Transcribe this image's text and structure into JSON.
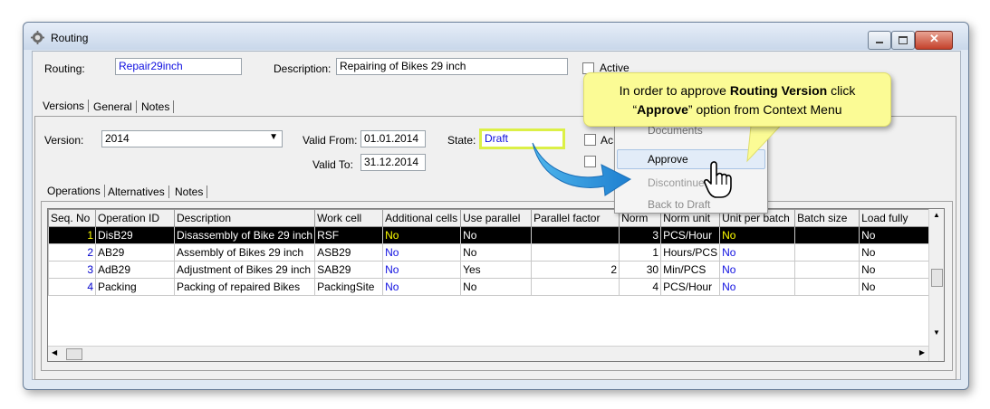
{
  "window": {
    "title": "Routing"
  },
  "header": {
    "routing_label": "Routing:",
    "routing_value": "Repair29inch",
    "description_label": "Description:",
    "description_value": "Repairing of Bikes 29 inch",
    "active_label": "Active"
  },
  "tabs": [
    "Versions",
    "General",
    "Notes"
  ],
  "version": {
    "version_label": "Version:",
    "version_value": "2014",
    "valid_from_label": "Valid From:",
    "valid_from_value": "01.01.2014",
    "valid_to_label": "Valid To:",
    "valid_to_value": "31.12.2014",
    "state_label": "State:",
    "state_value": "Draft",
    "checkbox_partial_label": "Ac"
  },
  "inner_tabs": [
    "Operations",
    "Alternatives",
    "Notes"
  ],
  "grid": {
    "columns": [
      "Seq. No",
      "Operation ID",
      "Description",
      "Work cell",
      "Additional cells",
      "Use parallel",
      "Parallel factor",
      "Norm",
      "Norm unit",
      "Unit per batch",
      "Batch size",
      "Load fully"
    ],
    "rows": [
      [
        "1",
        "DisB29",
        "Disassembly of Bike 29 inch",
        "RSF",
        "No",
        "No",
        "",
        "3",
        "PCS/Hour",
        "No",
        "",
        "No"
      ],
      [
        "2",
        "AB29",
        "Assembly of Bikes 29 inch",
        "ASB29",
        "No",
        "No",
        "",
        "1",
        "Hours/PCS",
        "No",
        "",
        "No"
      ],
      [
        "3",
        "AdB29",
        "Adjustment of Bikes 29 inch",
        "SAB29",
        "No",
        "Yes",
        "2",
        "30",
        "Min/PCS",
        "No",
        "",
        "No"
      ],
      [
        "4",
        "Packing",
        "Packing of repaired Bikes",
        "PackingSite",
        "No",
        "No",
        "",
        "4",
        "PCS/Hour",
        "No",
        "",
        "No"
      ]
    ]
  },
  "context_menu": {
    "items": [
      "Documents",
      "Approve",
      "Discontinue",
      "Back to Draft"
    ]
  },
  "callout": {
    "line1_pre": "In order to approve ",
    "line1_bold": "Routing Version",
    "line1_post": " click",
    "line2_pre": "“",
    "line2_bold": "Approve",
    "line2_post": "” option from Context Menu"
  },
  "colors": {
    "callout_bg": "#fbfb95",
    "accent_blue": "#1010e0",
    "selected_row": "#000000"
  }
}
